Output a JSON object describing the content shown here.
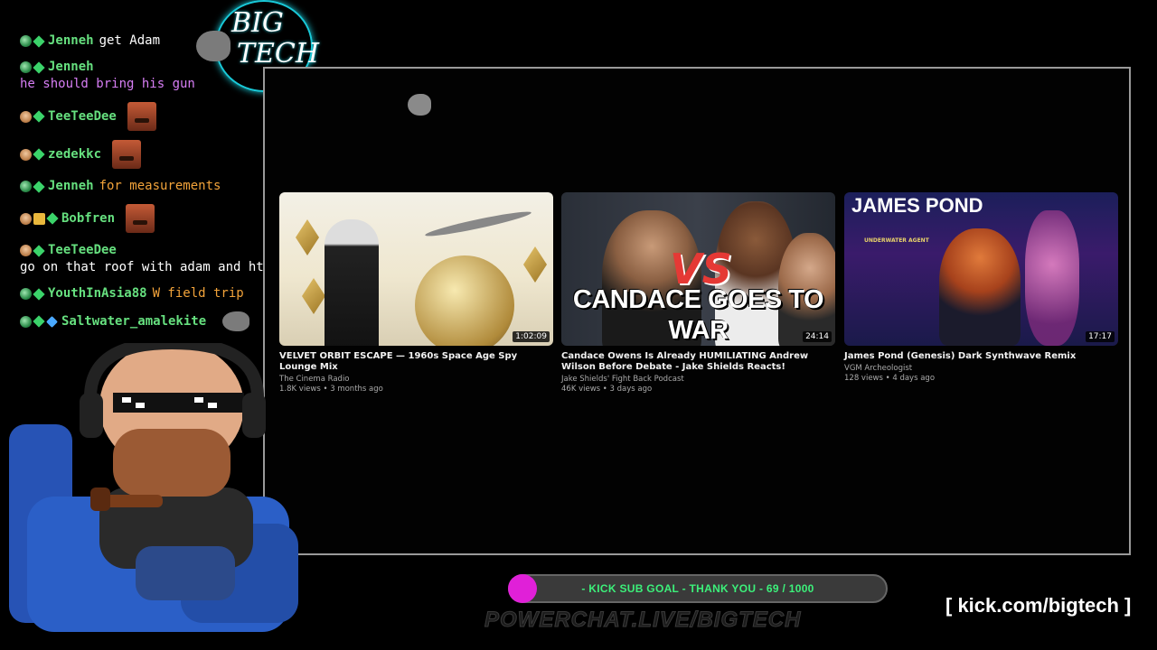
{
  "logo": {
    "line1": "BIG",
    "line2": "TECH"
  },
  "chat": [
    {
      "user": "Jenneh",
      "text": "get Adam",
      "user_color": "#66e07f",
      "text_color": "#ffffff",
      "badges": [
        "glob-icon",
        "diamond-icon"
      ]
    },
    {
      "user": "Jenneh",
      "text": "he should bring his gun",
      "user_color": "#66e07f",
      "text_color": "#d77ef5",
      "badges": [
        "glob-icon",
        "diamond-icon"
      ]
    },
    {
      "user": "TeeTeeDee",
      "text": "",
      "user_color": "#66e07f",
      "text_color": "#ffffff",
      "badges": [
        "face-icon",
        "diamond-icon"
      ]
    },
    {
      "user": "zedekkc",
      "text": "",
      "user_color": "#66e07f",
      "text_color": "#ffffff",
      "badges": [
        "face-icon",
        "diamond-icon"
      ]
    },
    {
      "user": "Jenneh",
      "text": "for measurements",
      "user_color": "#66e07f",
      "text_color": "#f2a33a",
      "badges": [
        "glob-icon",
        "diamond-icon"
      ]
    },
    {
      "user": "Bobfren",
      "text": "",
      "user_color": "#66e07f",
      "text_color": "#ffffff",
      "badges": [
        "face-icon",
        "gift-icon",
        "diamond-icon"
      ]
    },
    {
      "user": "TeeTeeDee",
      "text": "go on that roof with adam and ht",
      "user_color": "#66e07f",
      "text_color": "#ffffff",
      "badges": [
        "face-icon",
        "diamond-icon"
      ]
    },
    {
      "user": "YouthInAsia88",
      "text": "W field trip",
      "user_color": "#66e07f",
      "text_color": "#f2a33a",
      "badges": [
        "glob-icon",
        "diamond-icon"
      ]
    },
    {
      "user": "Saltwater_amalekite",
      "text": "",
      "user_color": "#66e07f",
      "text_color": "#ffffff",
      "badges": [
        "glob-icon",
        "diamond-icon",
        "sword-icon"
      ]
    }
  ],
  "videos": [
    {
      "title": "VELVET ORBIT ESCAPE — 1960s Space Age Spy Lounge Mix",
      "channel": "The Cinema Radio",
      "meta": "1.8K views • 3 months ago",
      "duration": "1:02:09"
    },
    {
      "title": "Candace Owens Is Already HUMILIATING Andrew Wilson Before Debate - Jake Shields Reacts!",
      "channel": "Jake Shields' Fight Back Podcast",
      "meta": "46K views • 3 days ago",
      "duration": "24:14",
      "thumb_vs": "VS",
      "thumb_caption": "CANDACE GOES TO WAR"
    },
    {
      "title": "James Pond (Genesis) Dark Synthwave Remix",
      "channel": "VGM Archeologist",
      "meta": "128 views • 4 days ago",
      "duration": "17:17",
      "thumb_title": "JAMES POND",
      "thumb_sub": "UNDERWATER AGENT"
    }
  ],
  "sub_goal": {
    "label": "- KICK SUB GOAL - THANK YOU - 69 / 1000",
    "current": 69,
    "target": 1000,
    "dot_color": "#e020d8",
    "text_color": "#3cf07a"
  },
  "watermark": "POWERCHAT.LIVE/BIGTECH",
  "kick_link": "[ kick.com/bigtech ]"
}
